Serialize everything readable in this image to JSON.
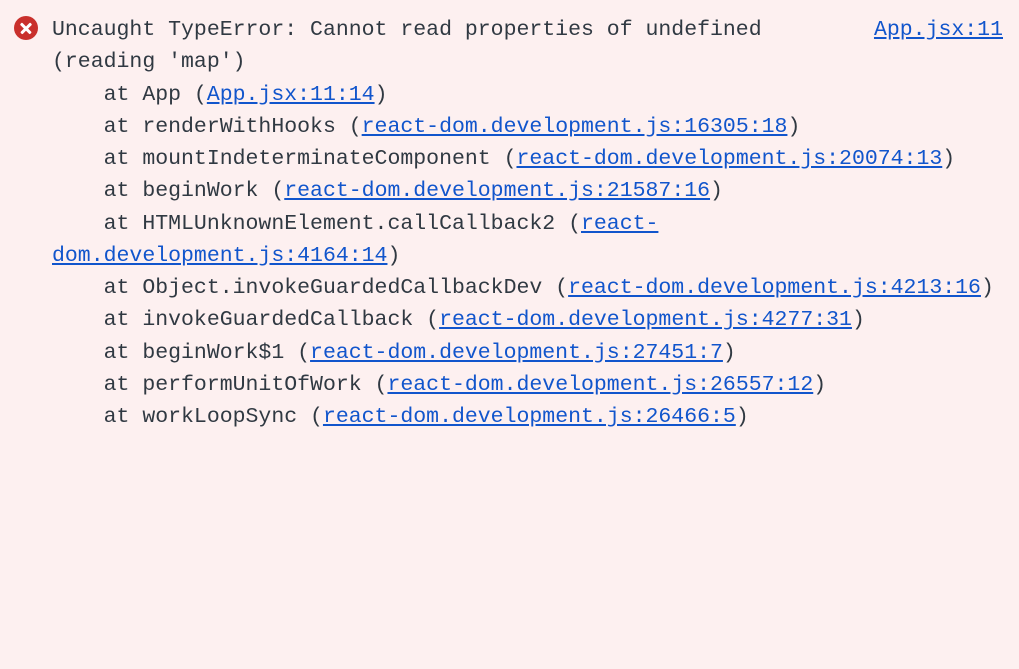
{
  "error": {
    "source_link": "App.jsx:11",
    "message": "Uncaught TypeError: Cannot read properties of undefined (reading 'map')",
    "frames": [
      {
        "before": "    at App (",
        "link": "App.jsx:11:14",
        "after": ")"
      },
      {
        "before": "    at renderWithHooks (",
        "link": "react-dom.development.js:16305:18",
        "after": ")"
      },
      {
        "before": "    at mountIndeterminateComponent (",
        "link": "react-dom.development.js:20074:13",
        "after": ")"
      },
      {
        "before": "    at beginWork (",
        "link": "react-dom.development.js:21587:16",
        "after": ")"
      },
      {
        "before": "    at HTMLUnknownElement.callCallback2 (",
        "link": "react-dom.development.js:4164:14",
        "after": ")"
      },
      {
        "before": "    at Object.invokeGuardedCallbackDev (",
        "link": "react-dom.development.js:4213:16",
        "after": ")"
      },
      {
        "before": "    at invokeGuardedCallback (",
        "link": "react-dom.development.js:4277:31",
        "after": ")"
      },
      {
        "before": "    at beginWork$1 (",
        "link": "react-dom.development.js:27451:7",
        "after": ")"
      },
      {
        "before": "    at performUnitOfWork (",
        "link": "react-dom.development.js:26557:12",
        "after": ")"
      },
      {
        "before": "    at workLoopSync (",
        "link": "react-dom.development.js:26466:5",
        "after": ")"
      }
    ]
  }
}
